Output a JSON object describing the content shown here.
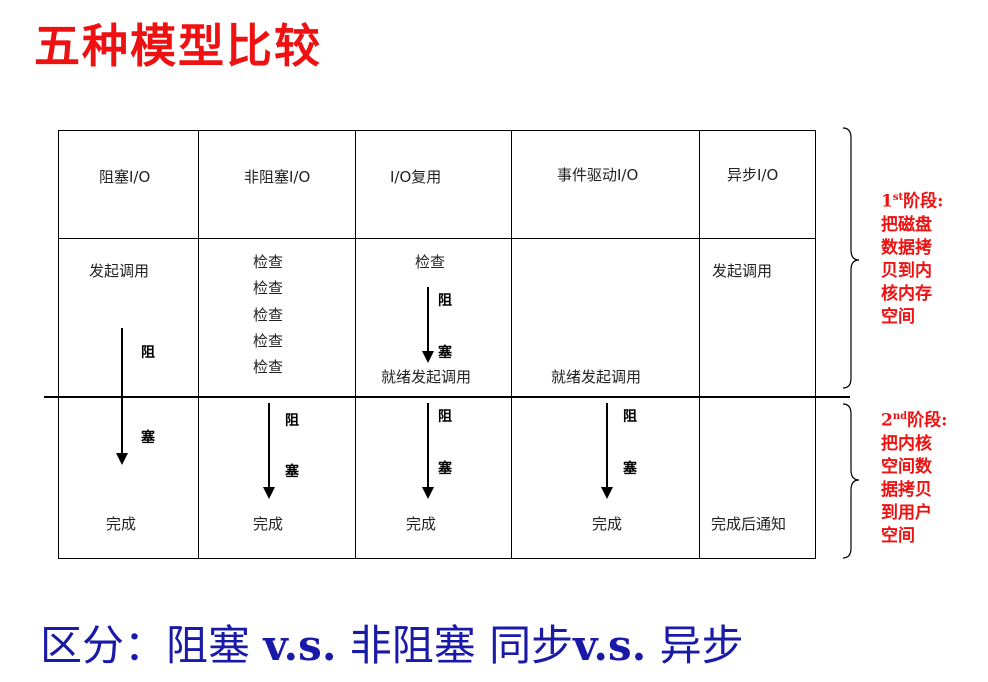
{
  "title": "五种模型比较",
  "columns": {
    "blocking": "阻塞I/O",
    "nonblocking": "非阻塞I/O",
    "multiplexing": "I/O复用",
    "event_driven": "事件驱动I/O",
    "async": "异步I/O"
  },
  "cells": {
    "initiate_call": "发起调用",
    "check": "检查",
    "ready_initiate_call": "就绪发起调用",
    "complete": "完成",
    "complete_notify": "完成后通知",
    "block_char_1": "阻",
    "block_char_2": "塞"
  },
  "stage1": {
    "number": "1",
    "suffix": "st",
    "text_1": "阶段:",
    "text_2": "把磁盘",
    "text_3": "数据拷",
    "text_4": "贝到内",
    "text_5": "核内存",
    "text_6": "空间"
  },
  "stage2": {
    "number": "2",
    "suffix": "nd",
    "text_1": "阶段:",
    "text_2": "把内核",
    "text_3": "空间数",
    "text_4": "据拷贝",
    "text_5": "到用户",
    "text_6": "空间"
  },
  "footer": {
    "prefix": "区分：",
    "blocking": "阻塞 ",
    "vs1": "v.s.",
    "nonblocking": " 非阻塞  同步",
    "vs2": "v.s.",
    "async": " 异步"
  }
}
